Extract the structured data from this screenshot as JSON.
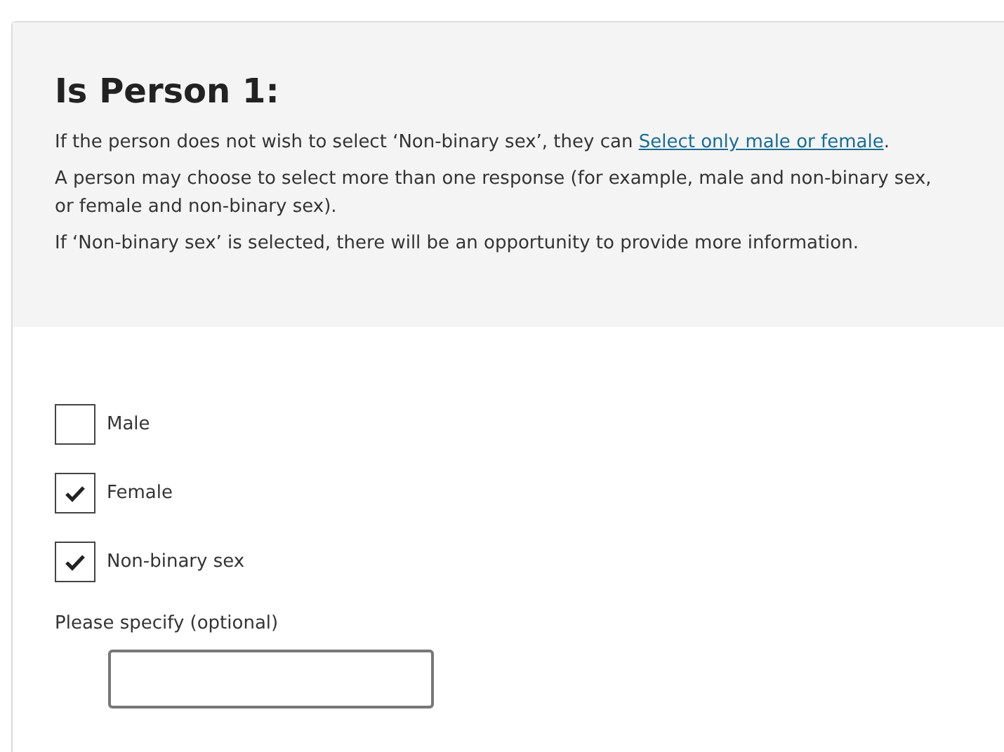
{
  "heading": "Is Person 1:",
  "intro": {
    "before": "If the person does not wish to select ‘Non-binary sex’, they can ",
    "link": "Select only male or female",
    "after": "."
  },
  "paragraphs": [
    "A person may choose to select more than one response (for example, male and non-binary sex, or female and non-binary sex).",
    "If ‘Non-binary sex’ is selected, there will be an opportunity to provide more information."
  ],
  "options": [
    {
      "label": "Male",
      "checked": false
    },
    {
      "label": "Female",
      "checked": true
    },
    {
      "label": "Non-binary sex",
      "checked": true
    }
  ],
  "specify": {
    "label": "Please specify (optional)"
  }
}
